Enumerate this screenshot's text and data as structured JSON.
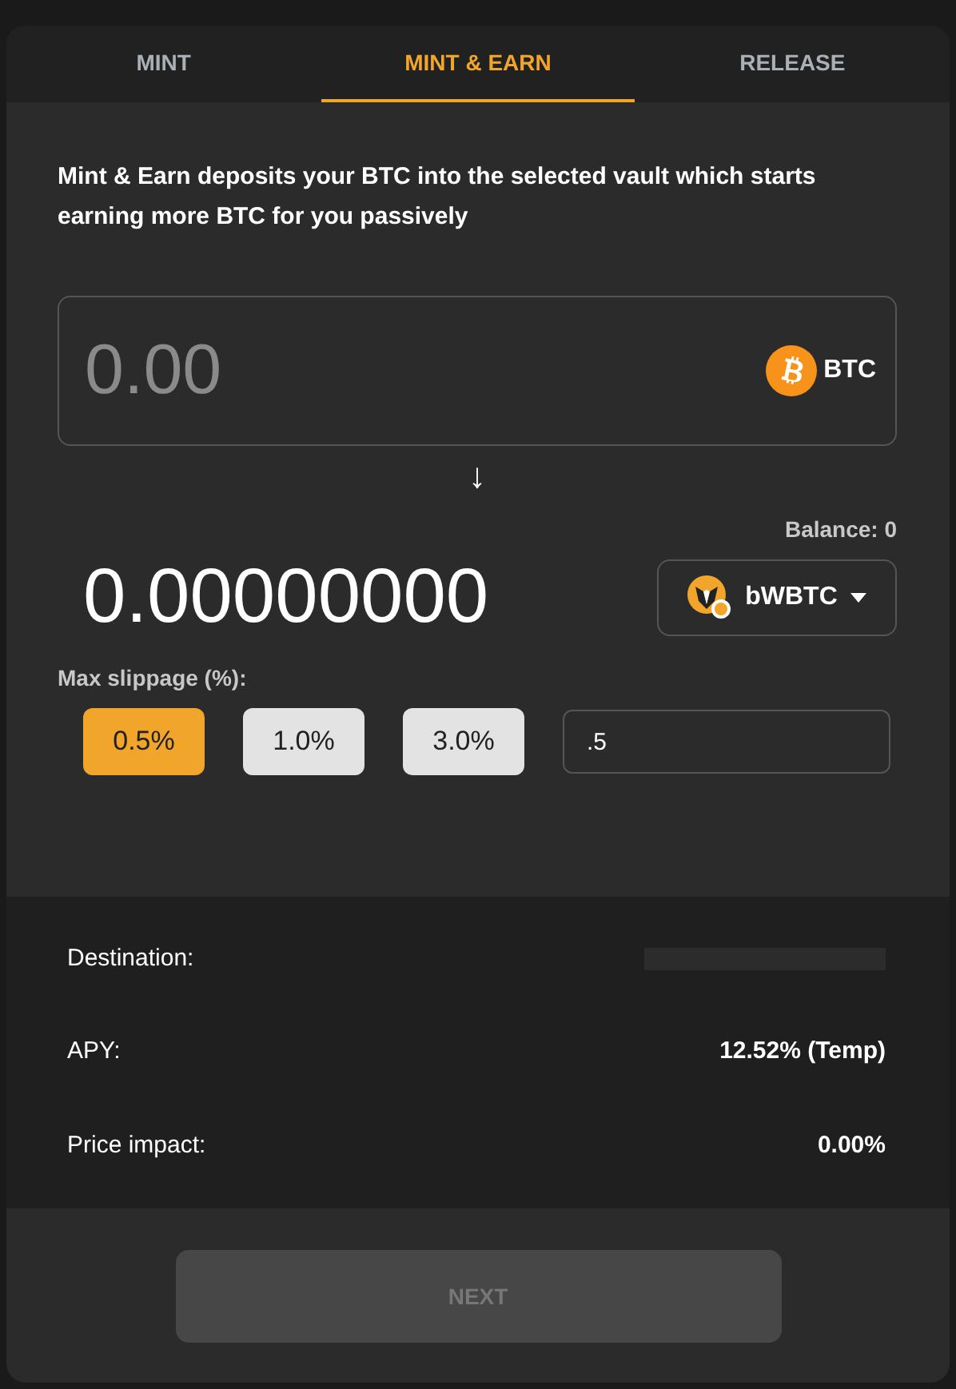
{
  "tabs": [
    {
      "label": "MINT",
      "selected": false
    },
    {
      "label": "MINT & EARN",
      "selected": true
    },
    {
      "label": "RELEASE",
      "selected": false
    }
  ],
  "description": "Mint & Earn deposits your BTC into the selected vault which starts earning more BTC for you passively",
  "amount_input": {
    "placeholder": "0.00",
    "token": "BTC"
  },
  "arrow": "↓",
  "balance": "Balance: 0",
  "output_amount": "0.00000000",
  "vault_select": {
    "token": "bWBTC"
  },
  "slippage": {
    "label": "Max slippage (%):",
    "options": [
      {
        "label": "0.5%",
        "selected": true
      },
      {
        "label": "1.0%",
        "selected": false
      },
      {
        "label": "3.0%",
        "selected": false
      }
    ],
    "custom_value": ".5"
  },
  "details": [
    {
      "label": "Destination:",
      "kind": "loading"
    },
    {
      "label": "APY:",
      "kind": "text",
      "value": "12.52% (Temp)"
    },
    {
      "label": "Price impact:",
      "kind": "text",
      "value": "0.00%"
    }
  ],
  "next_button": {
    "label": "NEXT",
    "disabled": true
  }
}
